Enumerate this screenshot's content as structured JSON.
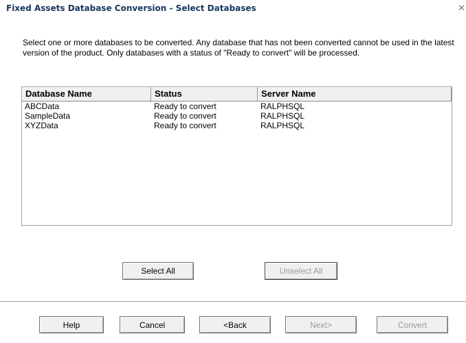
{
  "window": {
    "title": "Fixed Assets Database Conversion - Select Databases",
    "close_glyph": "✕"
  },
  "instructions": "Select one or more databases to be converted. Any database that has not been converted cannot be used in the latest version of the product. Only databases with a status of \"Ready to convert\" will be processed.",
  "table": {
    "columns": [
      "Database Name",
      "Status",
      "Server Name"
    ],
    "rows": [
      {
        "name": "ABCData",
        "status": "Ready to convert",
        "server": "RALPHSQL"
      },
      {
        "name": "SampleData",
        "status": "Ready to convert",
        "server": "RALPHSQL"
      },
      {
        "name": "XYZData",
        "status": "Ready to convert",
        "server": "RALPHSQL"
      }
    ]
  },
  "buttons": {
    "select_all": "Select All",
    "unselect_all": "Unselect All",
    "help": "Help",
    "cancel": "Cancel",
    "back": "<Back",
    "next": "Next>",
    "convert": "Convert"
  },
  "icons": {
    "close": "close-icon"
  },
  "colors": {
    "title": "#17375e",
    "disabled_text": "#9a9a9a",
    "button_face": "#f0f0f0"
  }
}
